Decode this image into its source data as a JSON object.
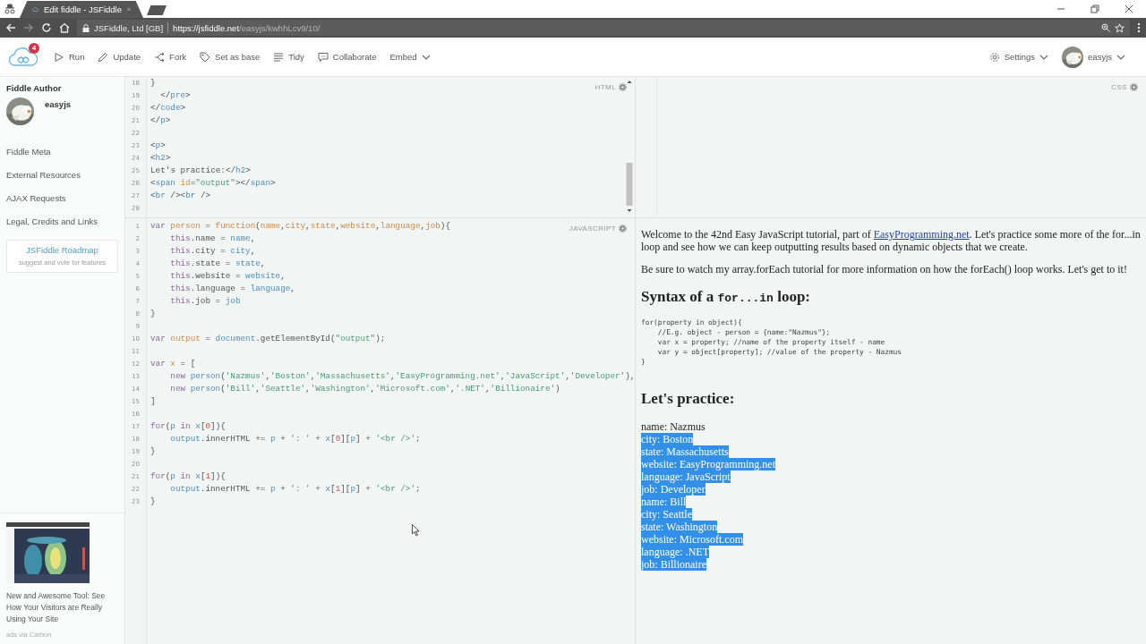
{
  "browser": {
    "tab_title": "Edit fiddle - JSFiddle",
    "site_identity": "JSFiddle, Ltd [GB]",
    "url_host": "https://jsfiddle.net",
    "url_path": "/easyjs/kwhhLcv9/10/"
  },
  "toolbar": {
    "badge": "4",
    "items": [
      {
        "kind": "play",
        "label": "Run"
      },
      {
        "kind": "pencil",
        "label": "Update"
      },
      {
        "kind": "fork",
        "label": "Fork"
      },
      {
        "kind": "tag",
        "label": "Set as base"
      },
      {
        "kind": "lines",
        "label": "Tidy"
      },
      {
        "kind": "chat",
        "label": "Collaborate"
      },
      {
        "kind": "menu",
        "label": "Embed"
      }
    ],
    "settings": "Settings",
    "user": "easyjs"
  },
  "sidebar": {
    "author_heading": "Fiddle Author",
    "author": "easyjs",
    "items": [
      "Fiddle Meta",
      "External Resources",
      "AJAX Requests",
      "Legal, Credits and Links"
    ],
    "roadmap": {
      "title": "JSFiddle Roadmap",
      "subtitle": "suggest and vote for features"
    },
    "ad": {
      "text": "New and Awesome Tool: See How Your Visitors are Really Using Your Site",
      "credit": "ads via Carbon"
    }
  },
  "html_panel": {
    "label": "HTML",
    "kind": "html",
    "lines": [
      {
        "n": "18",
        "text": "}"
      },
      {
        "n": "19",
        "text": "  </pre>"
      },
      {
        "n": "20",
        "text": "</code>"
      },
      {
        "n": "21",
        "text": "</p>"
      },
      {
        "n": "22"
      },
      {
        "n": "23",
        "text": "<p>"
      },
      {
        "n": "24",
        "text": "<h2>"
      },
      {
        "n": "25",
        "text": "Let's practice:</h2>"
      },
      {
        "n": "26",
        "text": "<span id=\"output\"></span>"
      },
      {
        "n": "27",
        "text": "<br /><br />"
      },
      {
        "n": "28"
      }
    ]
  },
  "js_panel": {
    "label": "JAVASCRIPT",
    "kind": "js",
    "lines": [
      {
        "n": "1",
        "text": "var person = function(name,city,state,website,language,job){"
      },
      {
        "n": "2",
        "text": "    this.name = name,"
      },
      {
        "n": "3",
        "text": "    this.city = city,"
      },
      {
        "n": "4",
        "text": "    this.state = state,"
      },
      {
        "n": "5",
        "text": "    this.website = website,"
      },
      {
        "n": "6",
        "text": "    this.language = language,"
      },
      {
        "n": "7",
        "text": "    this.job = job"
      },
      {
        "n": "8",
        "text": "}"
      },
      {
        "n": "9"
      },
      {
        "n": "10",
        "text": "var output = document.getElementById(\"output\");"
      },
      {
        "n": "11"
      },
      {
        "n": "12",
        "text": "var x = ["
      },
      {
        "n": "13",
        "text": "    new person('Nazmus','Boston','Massachusetts','EasyProgramming.net','JavaScript','Developer'),"
      },
      {
        "n": "14",
        "text": "    new person('Bill','Seattle','Washington','Microsoft.com','.NET','Billionaire')"
      },
      {
        "n": "15",
        "text": "]"
      },
      {
        "n": "16"
      },
      {
        "n": "17",
        "text": "for(p in x[0]){"
      },
      {
        "n": "18",
        "text": "    output.innerHTML += p + ': ' + x[0][p] + '<br />';"
      },
      {
        "n": "19",
        "text": "}"
      },
      {
        "n": "20"
      },
      {
        "n": "21",
        "text": "for(p in x[1]){"
      },
      {
        "n": "22",
        "text": "    output.innerHTML += p + ': ' + x[1][p] + '<br />';"
      },
      {
        "n": "23",
        "text": "}"
      }
    ]
  },
  "css_panel": {
    "label": "CSS"
  },
  "result": {
    "intro": {
      "before": "Welcome to the 42nd Easy JavaScript tutorial, part of ",
      "link": "EasyProgramming.net",
      "after": ". Let's practice some more of the for...in loop and see how we can keep outputting results based on dynamic objects that we create."
    },
    "paragraph": "Be sure to watch my array.forEach tutorial for more information on how the forEach() loop works. Let's get to it!",
    "syntax_heading": {
      "before": "Syntax of a ",
      "code": "for...in",
      "after": " loop:"
    },
    "pre_lines": [
      "for(property in object){",
      "    //E.g. object - person = {name:\"Nazmus\"};",
      "    var x = property; //name of the property itself - name",
      "    var y = object[property]; //value of the property - Nazmus",
      "}"
    ],
    "practice_heading": "Let's practice:",
    "output": [
      {
        "text": "name: Nazmus",
        "selected": false
      },
      {
        "text": "city: Boston",
        "selected": true
      },
      {
        "text": "state: Massachusetts",
        "selected": true
      },
      {
        "text": "website: EasyProgramming.net",
        "selected": true
      },
      {
        "text": "language: JavaScript",
        "selected": true
      },
      {
        "text": "job: Developer",
        "selected": true
      },
      {
        "text": "name: Bill",
        "selected": true
      },
      {
        "text": "city: Seattle",
        "selected": true
      },
      {
        "text": "state: Washington",
        "selected": true
      },
      {
        "text": "website: Microsoft.com",
        "selected": true
      },
      {
        "text": "language: .NET",
        "selected": true
      },
      {
        "text": "job: Billionaire",
        "selected": true
      }
    ]
  }
}
